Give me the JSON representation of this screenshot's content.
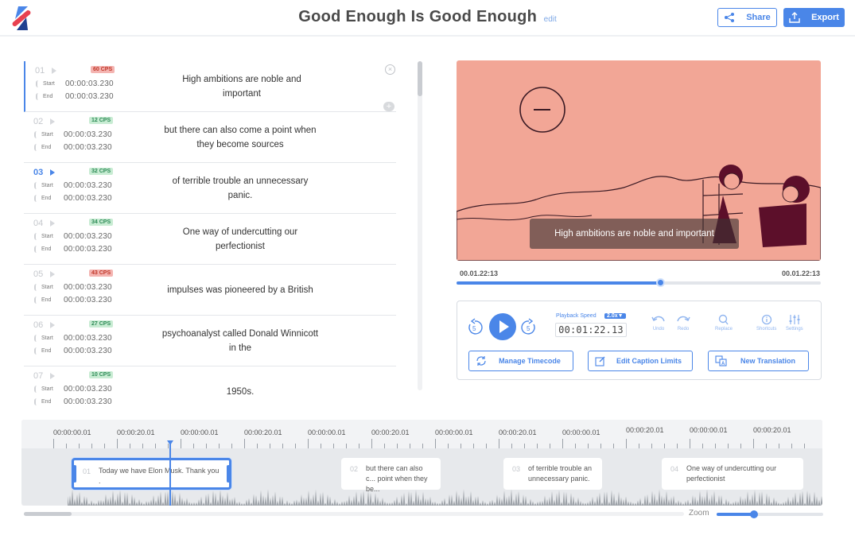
{
  "header": {
    "title": "Good Enough Is Good Enough",
    "edit_label": "edit",
    "share_label": "Share",
    "export_label": "Export",
    "logo_icon": "brand-logo-icon"
  },
  "colors": {
    "accent": "#4a86e8",
    "video_bg": "#f2a696",
    "cps_red": "#f4b4b1",
    "cps_green": "#c8ecd3"
  },
  "subtitles": {
    "start_label": "Start",
    "end_label": "End",
    "rows": [
      {
        "num": "01",
        "cps": "60 CPS",
        "cps_level": "red",
        "start": "00:00:03.230",
        "end": "00:00:03.230",
        "text": "High ambitions are noble and important"
      },
      {
        "num": "02",
        "cps": "12 CPS",
        "cps_level": "green",
        "start": "00:00:03.230",
        "end": "00:00:03.230",
        "text": "but there can also come a point when they become sources"
      },
      {
        "num": "03",
        "cps": "32 CPS",
        "cps_level": "green",
        "start": "00:00:03.230",
        "end": "00:00:03.230",
        "text": "of terrible trouble an unnecessary panic."
      },
      {
        "num": "04",
        "cps": "34 CPS",
        "cps_level": "green",
        "start": "00:00:03.230",
        "end": "00:00:03.230",
        "text": "One way of undercutting our perfectionist"
      },
      {
        "num": "05",
        "cps": "43 CPS",
        "cps_level": "red",
        "start": "00:00:03.230",
        "end": "00:00:03.230",
        "text": "impulses was pioneered by a British"
      },
      {
        "num": "06",
        "cps": "27 CPS",
        "cps_level": "green",
        "start": "00:00:03.230",
        "end": "00:00:03.230",
        "text": "psychoanalyst called Donald Winnicott in the"
      },
      {
        "num": "07",
        "cps": "10 CPS",
        "cps_level": "green",
        "start": "00:00:03.230",
        "end": "00:00:03.230",
        "text": "1950s."
      }
    ]
  },
  "video": {
    "caption": "High ambitions are noble and important",
    "time_left": "00.01.22:13",
    "time_right": "00.01.22:13",
    "progress_fraction": 0.56
  },
  "controls": {
    "speed_label": "Playback Speed",
    "speed_value": "2.0x▼",
    "current_time": "00:01:22.13",
    "rewind_icon": "rewind-5-icon",
    "forward_icon": "forward-5-icon",
    "tools": [
      {
        "label": "Undo",
        "icon": "undo-icon"
      },
      {
        "label": "Redo",
        "icon": "redo-icon"
      },
      {
        "label": "Replace",
        "icon": "search-icon"
      },
      {
        "label": "Shortcuts",
        "icon": "info-icon"
      },
      {
        "label": "Settings",
        "icon": "sliders-icon"
      }
    ],
    "manage_timecode": "Manage Timecode",
    "edit_caption_limits": "Edit Caption Limits",
    "new_translation": "New Translation"
  },
  "timeline": {
    "ruler_labels": [
      "00:00:00.01",
      "00:00:20.01",
      "00:00:00.01",
      "00:00:20.01",
      "00:00:00.01",
      "00:00:20.01",
      "00:00:00.01",
      "00:00:20.01",
      "00:00:00.01",
      "00:00:20.01",
      "00:00:00.01",
      "00:00:20.01"
    ],
    "clips": [
      {
        "num": "01",
        "text": "Today we have Elon Musk. Thank you ."
      },
      {
        "num": "02",
        "text": "but there can also c... point when they be..."
      },
      {
        "num": "03",
        "text": "of terrible trouble an unnecessary panic."
      },
      {
        "num": "04",
        "text": "One way of undercutting our perfectionist"
      }
    ],
    "zoom_label": "Zoom",
    "zoom_fraction": 0.35
  }
}
